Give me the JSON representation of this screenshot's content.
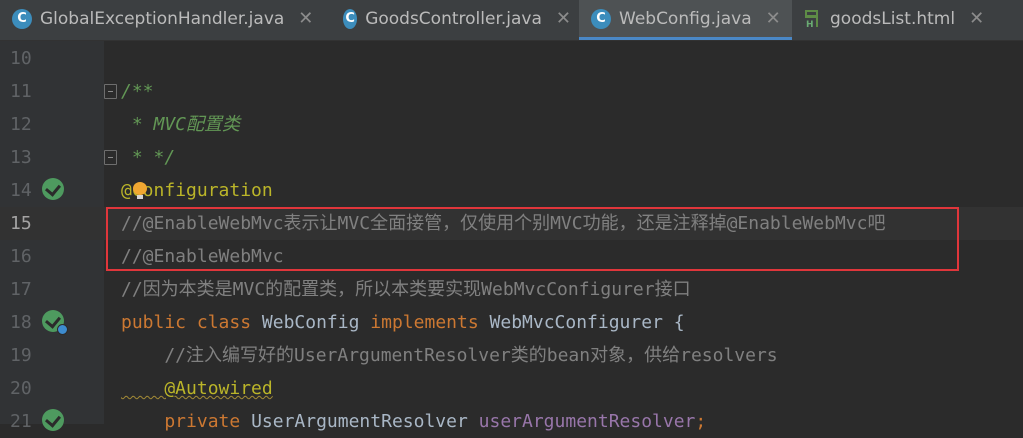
{
  "tabs": [
    {
      "label": "GlobalExceptionHandler.java",
      "type": "java",
      "icon_char": "C",
      "active": false
    },
    {
      "label": "GoodsController.java",
      "type": "java",
      "icon_char": "C",
      "active": false
    },
    {
      "label": "WebConfig.java",
      "type": "java",
      "icon_char": "C",
      "active": true
    },
    {
      "label": "goodsList.html",
      "type": "html",
      "icon_char": "H",
      "active": false
    }
  ],
  "close_glyph": "✕",
  "lines": [
    {
      "num": "10",
      "text": ""
    },
    {
      "num": "11",
      "text": "/**"
    },
    {
      "num": "12",
      "text": " * MVC配置类"
    },
    {
      "num": "13",
      "text": " * */"
    },
    {
      "num": "14",
      "text_at": "@",
      "text_rest": "Configuration"
    },
    {
      "num": "15",
      "text": "//@EnableWebMvc表示让MVC全面接管，仅使用个别MVC功能，还是注释掉@EnableWebMvc吧"
    },
    {
      "num": "16",
      "text": "//@EnableWebMvc"
    },
    {
      "num": "17",
      "text": "//因为本类是MVC的配置类，所以本类要实现WebMvcConfigurer接口"
    },
    {
      "num": "18",
      "kw1": "public",
      "kw2": "class",
      "name": "WebConfig",
      "kw3": "implements",
      "iface": "WebMvcConfigurer",
      "brace": "{"
    },
    {
      "num": "19",
      "text": "    //注入编写好的UserArgumentResolver类的bean对象，供给resolvers"
    },
    {
      "num": "20",
      "text": "    @Autowired"
    },
    {
      "num": "21",
      "kw1": "    private",
      "type": "UserArgumentResolver",
      "field": "userArgumentResolver",
      "semi": ";"
    }
  ],
  "colors": {
    "background": "#2b2b2b",
    "keyword": "#cc7832",
    "annotation": "#bbb529",
    "comment": "#808080",
    "doc_comment": "#629755",
    "field": "#9876aa",
    "highlight_box": "#e0363b"
  }
}
